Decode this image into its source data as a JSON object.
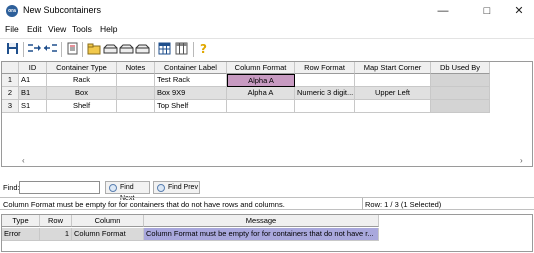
{
  "window": {
    "title": "New Subcontainers",
    "icon_text": "ora",
    "controls": [
      "minimize-icon",
      "maximize-icon",
      "close-icon"
    ]
  },
  "menu": [
    "File",
    "Edit",
    "View",
    "Tools",
    "Help"
  ],
  "toolbar": {
    "buttons": [
      "save-icon",
      "split-right-icon",
      "split-left-icon",
      "document-icon",
      "open-folder-icon",
      "tray-icon",
      "tray-icon",
      "tray-icon",
      "table-icon",
      "column-select-icon",
      "help-icon"
    ]
  },
  "grid": {
    "columns": [
      "ID",
      "Container Type",
      "Notes",
      "Container Label",
      "Column Format",
      "Row Format",
      "Map Start Corner",
      "Db Used By"
    ],
    "rows": [
      {
        "num": "1",
        "id": "A1",
        "type": "Rack",
        "notes": "",
        "label": "Test Rack",
        "col_format": "Alpha A",
        "row_format": "",
        "start_corner": "",
        "db_used_by": ""
      },
      {
        "num": "2",
        "id": "B1",
        "type": "Box",
        "notes": "",
        "label": "Box 9X9",
        "col_format": "Alpha A",
        "row_format": "Numeric 3 digit...",
        "start_corner": "Upper Left",
        "db_used_by": ""
      },
      {
        "num": "3",
        "id": "S1",
        "type": "Shelf",
        "notes": "",
        "label": "Top Shelf",
        "col_format": "",
        "row_format": "",
        "start_corner": "",
        "db_used_by": ""
      }
    ]
  },
  "find": {
    "label": "Find:",
    "value": "",
    "next_label": "Find Next",
    "prev_label": "Find Prev"
  },
  "status": {
    "message": "Column Format must be empty for for containers that do not have rows and columns.",
    "row_info": "Row: 1 / 3 (1 Selected)"
  },
  "messages": {
    "columns": [
      "Type",
      "Row",
      "Column",
      "Message"
    ],
    "rows": [
      {
        "type": "Error",
        "row": "1",
        "column": "Column Format",
        "message": "Column Format must be empty for for containers that do not have r..."
      }
    ]
  },
  "colors": {
    "selected_cell": "#c79ac1",
    "message_highlight": "#a9a8dc",
    "db_used_cell": "#d4d4d4"
  }
}
